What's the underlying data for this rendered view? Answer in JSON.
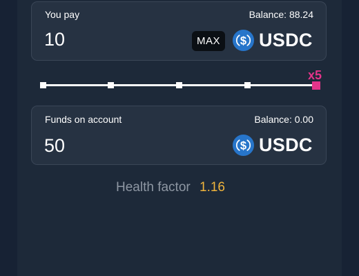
{
  "pay": {
    "label": "You pay",
    "balance": "Balance: 88.24",
    "amount": "10",
    "max_label": "MAX",
    "token": "USDC",
    "token_icon": "usdc-icon"
  },
  "leverage": {
    "steps": [
      1,
      2,
      3,
      4,
      5
    ],
    "selected_step": 5,
    "multiplier_label": "x5"
  },
  "funds": {
    "label": "Funds on account",
    "balance": "Balance: 0.00",
    "amount": "50",
    "token": "USDC",
    "token_icon": "usdc-icon"
  },
  "health": {
    "label": "Health factor",
    "value": "1.16"
  },
  "colors": {
    "background": "#172234",
    "panel": "#1d2939",
    "card": "#263242",
    "accent": "#e4348a",
    "usdc_blue": "#2775ca",
    "health_value": "#f0b43c"
  }
}
